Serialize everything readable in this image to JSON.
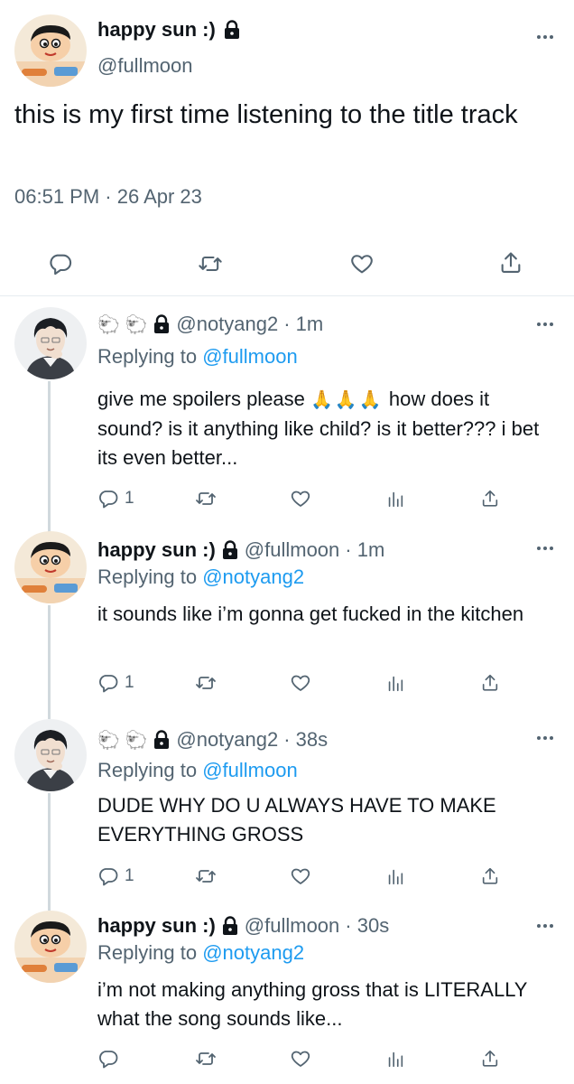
{
  "main_tweet": {
    "name": "happy sun :)",
    "handle": "@fullmoon",
    "text": "this is my first time listening to the title track",
    "timestamp": "06:51 PM · 26 Apr 23",
    "icons": [
      "reply-icon",
      "retweet-icon",
      "like-icon",
      "share-icon"
    ]
  },
  "replies": [
    {
      "name": "🐑 🐑",
      "handle": "@notyang2",
      "time": "· 1m",
      "replying_prefix": "Replying to",
      "replying_to": "@fullmoon",
      "text": "give me spoilers please",
      "text_emoji": "🙏🙏🙏",
      "text_rest": "how does it sound? is it anything like child? is it better??? i bet its even better...",
      "reply_count": "1"
    },
    {
      "name": "happy sun :)",
      "handle": "@fullmoon",
      "time": "· 1m",
      "replying_prefix": "Replying to",
      "replying_to": "@notyang2",
      "text": "it sounds like i’m gonna get fucked in the kitchen",
      "reply_count": "1"
    },
    {
      "name": "🐑 🐑",
      "handle": "@notyang2",
      "time": "· 38s",
      "replying_prefix": "Replying to",
      "replying_to": "@fullmoon",
      "text": "DUDE WHY DO U ALWAYS HAVE TO MAKE EVERYTHING GROSS",
      "reply_count": "1"
    },
    {
      "name": "happy sun :)",
      "handle": "@fullmoon",
      "time": "· 30s",
      "replying_prefix": "Replying to",
      "replying_to": "@notyang2",
      "text": "i’m not making anything gross that is LITERALLY what the song sounds like...",
      "reply_count": ""
    }
  ],
  "colors": {
    "text": "#0f1419",
    "secondary": "#536471",
    "link": "#1d9bf0",
    "divider": "#e6ecf0",
    "thread_line": "#d1d9dd"
  }
}
